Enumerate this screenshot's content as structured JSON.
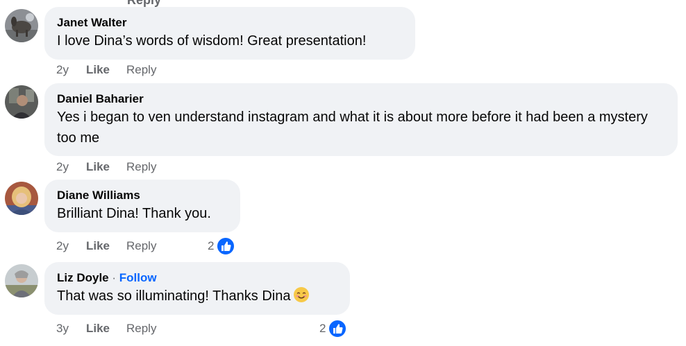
{
  "top_partial": {
    "reply_label": "Reply"
  },
  "comments": [
    {
      "author": "Janet Walter",
      "text": "I love Dina’s words of wisdom! Great presentation!",
      "time": "2y",
      "like_label": "Like",
      "reply_label": "Reply",
      "avatar_icon": "avatar-horse-photo"
    },
    {
      "author": "Daniel Baharier",
      "text": "Yes i began to ven understand instagram and what it is about more before it had been a mystery too me",
      "time": "2y",
      "like_label": "Like",
      "reply_label": "Reply",
      "avatar_icon": "avatar-person-photo"
    },
    {
      "author": "Diane Williams",
      "text": "Brilliant Dina! Thank you.",
      "time": "2y",
      "like_label": "Like",
      "reply_label": "Reply",
      "reaction_count": "2",
      "reaction_icon": "like-thumb-icon",
      "avatar_icon": "avatar-blonde-person-photo"
    },
    {
      "author": "Liz Doyle",
      "separator": "·",
      "follow_label": "Follow",
      "text": "That was so illuminating! Thanks Dina",
      "emoji": "smiling-face-emoji",
      "time": "3y",
      "like_label": "Like",
      "reply_label": "Reply",
      "reaction_count": "2",
      "reaction_icon": "like-thumb-icon",
      "avatar_icon": "avatar-outdoor-person-photo"
    }
  ],
  "colors": {
    "bubble_bg": "#f0f2f5",
    "meta_text": "#65676b",
    "follow_blue": "#0866ff",
    "like_badge_blue": "#0866ff"
  }
}
